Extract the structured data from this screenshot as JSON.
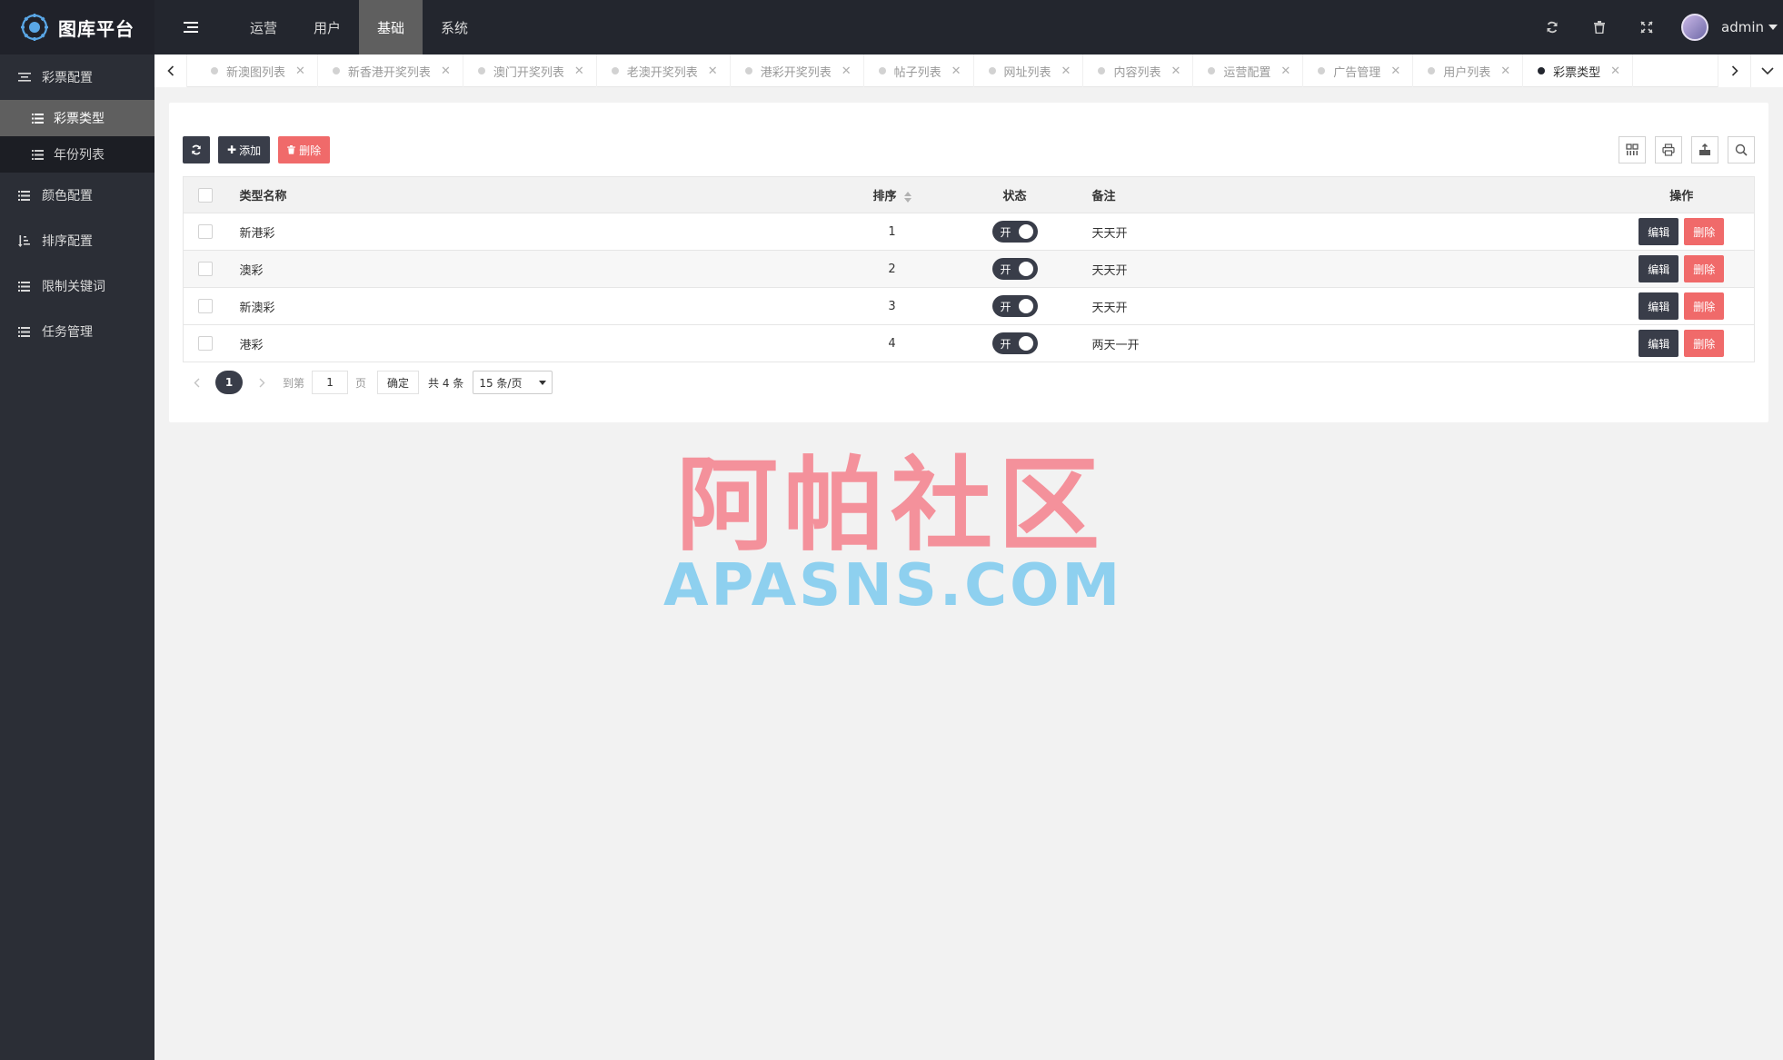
{
  "app": {
    "title": "图库平台"
  },
  "topnav": [
    {
      "label": "运营",
      "active": false
    },
    {
      "label": "用户",
      "active": false
    },
    {
      "label": "基础",
      "active": true
    },
    {
      "label": "系统",
      "active": false
    }
  ],
  "user": {
    "name": "admin"
  },
  "sidebar": {
    "groups": [
      {
        "label": "彩票配置",
        "icon": "sliders-icon",
        "children": [
          {
            "label": "彩票类型",
            "active": true
          },
          {
            "label": "年份列表",
            "active": false
          }
        ]
      },
      {
        "label": "颜色配置",
        "icon": "list-icon"
      },
      {
        "label": "排序配置",
        "icon": "sort-icon"
      },
      {
        "label": "限制关键词",
        "icon": "list-icon"
      },
      {
        "label": "任务管理",
        "icon": "list-icon"
      }
    ]
  },
  "tabs": [
    {
      "label": "新澳图列表",
      "active": false
    },
    {
      "label": "新香港开奖列表",
      "active": false
    },
    {
      "label": "澳门开奖列表",
      "active": false
    },
    {
      "label": "老澳开奖列表",
      "active": false
    },
    {
      "label": "港彩开奖列表",
      "active": false
    },
    {
      "label": "帖子列表",
      "active": false
    },
    {
      "label": "网址列表",
      "active": false
    },
    {
      "label": "内容列表",
      "active": false
    },
    {
      "label": "运营配置",
      "active": false
    },
    {
      "label": "广告管理",
      "active": false
    },
    {
      "label": "用户列表",
      "active": false
    },
    {
      "label": "彩票类型",
      "active": true
    }
  ],
  "toolbar": {
    "add_label": "添加",
    "delete_label": "删除"
  },
  "table": {
    "headers": {
      "name": "类型名称",
      "sort": "排序",
      "status": "状态",
      "remark": "备注",
      "op": "操作"
    },
    "rows": [
      {
        "name": "新港彩",
        "sort": "1",
        "status": "开",
        "remark": "天天开"
      },
      {
        "name": "澳彩",
        "sort": "2",
        "status": "开",
        "remark": "天天开"
      },
      {
        "name": "新澳彩",
        "sort": "3",
        "status": "开",
        "remark": "天天开"
      },
      {
        "name": "港彩",
        "sort": "4",
        "status": "开",
        "remark": "两天一开"
      }
    ],
    "edit_label": "编辑",
    "delete_label": "删除"
  },
  "pager": {
    "current": "1",
    "goto_label": "到第",
    "page_input": "1",
    "page_unit": "页",
    "confirm_label": "确定",
    "total_label": "共 4 条",
    "page_size": "15 条/页"
  },
  "watermark": {
    "cn": "阿帕社区",
    "en": "APASNS.COM"
  },
  "colors": {
    "header": "#23262e",
    "sidebar": "#2b2e36",
    "accent_dark": "#393d49",
    "danger": "#f06a6a"
  }
}
